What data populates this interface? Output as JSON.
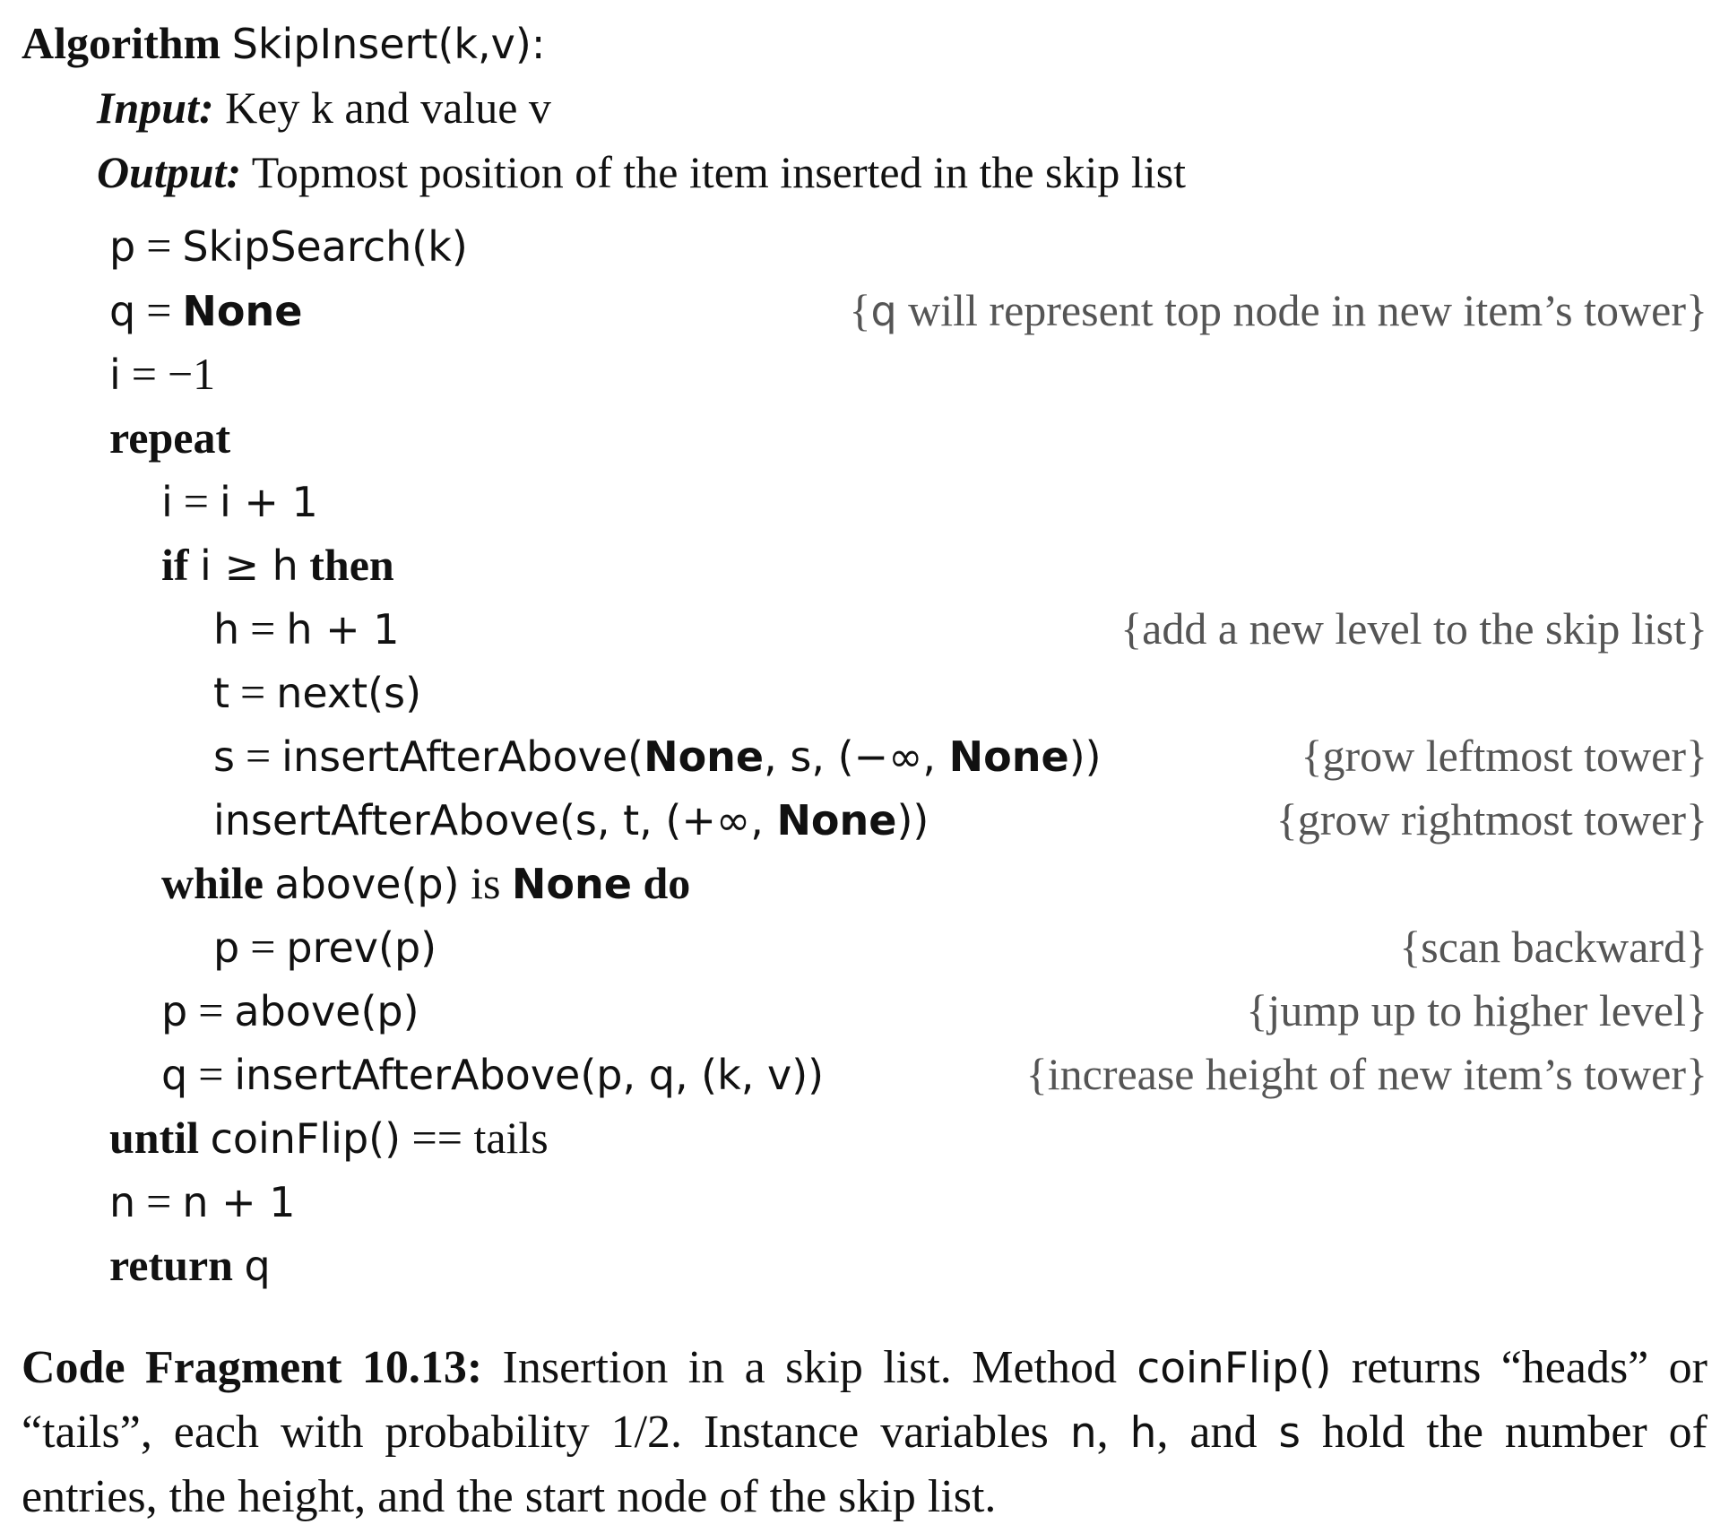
{
  "algorithm": {
    "keyword": "Algorithm",
    "signature": "SkipInsert(k,v):",
    "input_label": "Input:",
    "input_text": "Key k and value v",
    "output_label": "Output:",
    "output_text": "Topmost position of the item inserted in the skip list"
  },
  "keywords": {
    "repeat": "repeat",
    "if": "if",
    "then": "then",
    "while": "while",
    "is": "is",
    "none": "None",
    "do": "do",
    "until": "until",
    "return": "return"
  },
  "code": {
    "l1_lhs": "p",
    "l1_rhs": "SkipSearch(k)",
    "l2_lhs": "q",
    "l3_lhs": "i",
    "l3_rhs": "−1",
    "l4_lhs": "i",
    "l4_rhs": "i + 1",
    "l5_cond": "i ≥ h",
    "l6_lhs": "h",
    "l6_rhs": "h + 1",
    "l7_lhs": "t",
    "l7_rhs": "next(s)",
    "l8_lhs": "s",
    "l8_a": "insertAfterAbove(",
    "l8_b": ", s, (−∞, ",
    "l8_c": "))",
    "l9_a": "insertAfterAbove(s, t, (+∞, ",
    "l9_b": "))",
    "l10_expr": "above(p)",
    "l11_lhs": "p",
    "l11_rhs": "prev(p)",
    "l12_lhs": "p",
    "l12_rhs": "above(p)",
    "l13_lhs": "q",
    "l13_rhs": "insertAfterAbove(p, q, (k, v))",
    "l14_a": "coinFlip()",
    "l14_b": " == tails",
    "l15_lhs": "n",
    "l15_rhs": "n + 1",
    "l16_ret": "q"
  },
  "comments": {
    "c2_open": "{",
    "c2_var": "q",
    "c2_rest": " will represent top node in new item’s tower}",
    "c6": "{add a new level to the skip list}",
    "c8": "{grow leftmost tower}",
    "c9": "{grow rightmost tower}",
    "c11": "{scan backward}",
    "c12": "{jump up to higher level}",
    "c13": "{increase height of new item’s tower}"
  },
  "caption": {
    "label": "Code Fragment 10.13:",
    "t1": " Insertion in a skip list. Method ",
    "method": "coinFlip()",
    "t2": " returns “heads” or “tails”, each with probability 1/2. Instance variables ",
    "v1": "n",
    "t3": ", ",
    "v2": "h",
    "t4": ", and ",
    "v3": "s",
    "t5": " hold the number of entries, the height, and the start node of the skip list."
  }
}
